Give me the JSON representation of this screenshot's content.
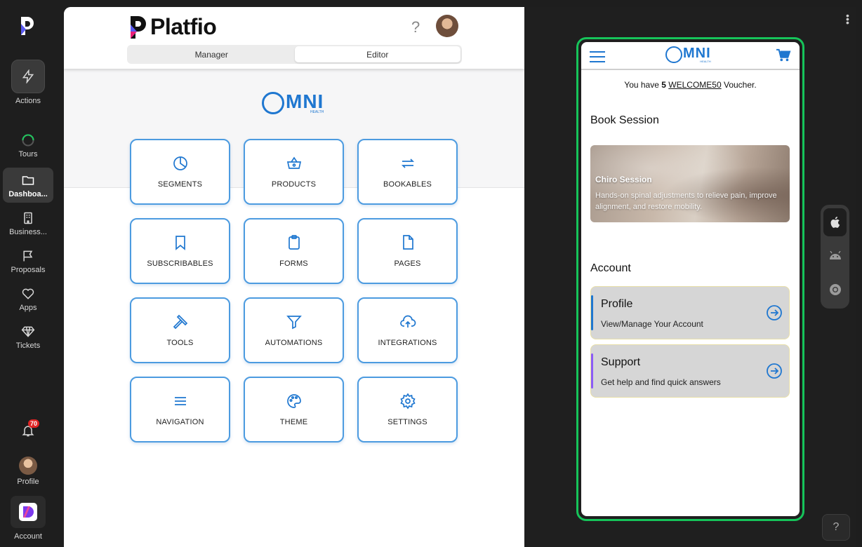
{
  "rail": {
    "items": [
      {
        "label": "Actions"
      },
      {
        "label": "Tours"
      },
      {
        "label": "Dashboa..."
      },
      {
        "label": "Business..."
      },
      {
        "label": "Proposals"
      },
      {
        "label": "Apps"
      },
      {
        "label": "Tickets"
      }
    ],
    "notifications_count": "70",
    "profile_label": "Profile",
    "account_label": "Account"
  },
  "header": {
    "brand": "Platfio",
    "help": "?",
    "tabs": [
      {
        "label": "Manager"
      },
      {
        "label": "Editor",
        "active": true
      }
    ]
  },
  "canvas": {
    "logo_text": "MNI",
    "logo_sub": "HEALTH",
    "tiles": [
      {
        "label": "SEGMENTS",
        "icon": "pie-chart-icon"
      },
      {
        "label": "PRODUCTS",
        "icon": "basket-icon"
      },
      {
        "label": "BOOKABLES",
        "icon": "repeat-icon"
      },
      {
        "label": "SUBSCRIBABLES",
        "icon": "bookmark-icon"
      },
      {
        "label": "FORMS",
        "icon": "clipboard-icon"
      },
      {
        "label": "PAGES",
        "icon": "file-icon"
      },
      {
        "label": "TOOLS",
        "icon": "hammer-icon"
      },
      {
        "label": "AUTOMATIONS",
        "icon": "filter-icon"
      },
      {
        "label": "INTEGRATIONS",
        "icon": "cloud-upload-icon"
      },
      {
        "label": "NAVIGATION",
        "icon": "menu-icon"
      },
      {
        "label": "THEME",
        "icon": "palette-icon"
      },
      {
        "label": "SETTINGS",
        "icon": "gear-icon"
      }
    ]
  },
  "preview": {
    "logo_text": "MNI",
    "logo_sub": "HEALTH",
    "voucher_prefix": "You have ",
    "voucher_count": "5",
    "voucher_code": "WELCOME50",
    "voucher_suffix": " Voucher.",
    "book_heading": "Book Session",
    "hero_title": "Chiro Session",
    "hero_desc": "Hands-on spinal adjustments to relieve pain, improve alignment, and restore mobility.",
    "account_heading": "Account",
    "cards": [
      {
        "title": "Profile",
        "subtitle": "View/Manage Your Account",
        "accent": "#1f77d0"
      },
      {
        "title": "Support",
        "subtitle": "Get help and find quick answers",
        "accent": "#8b5cf6"
      }
    ],
    "help": "?"
  },
  "colors": {
    "accent": "#1f77d0",
    "frame": "#16c45a",
    "badge": "#e02424"
  }
}
